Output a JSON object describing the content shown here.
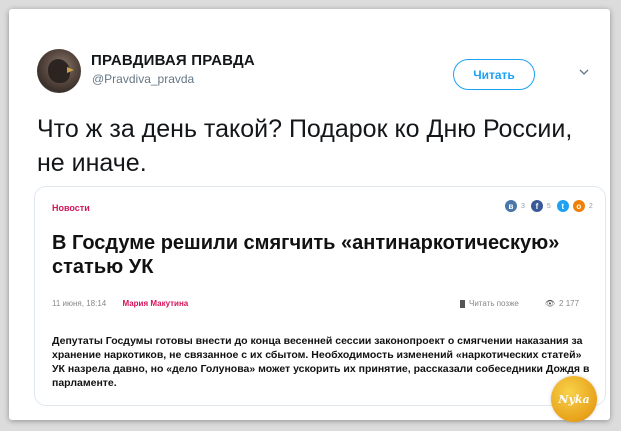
{
  "tweet": {
    "display_name": "ПРАВДИВАЯ ПРАВДА",
    "handle": "@Pravdiva_pravda",
    "follow_label": "Читать",
    "text": "Что ж за день такой? Подарок ко Дню России, не иначе."
  },
  "embed": {
    "section": "Новости",
    "share": {
      "vk_count": "3",
      "fb_count": "5",
      "ok_count": "2"
    },
    "headline": "В Госдуме решили смягчить «антинаркотическую» статью УК",
    "date": "11 июня, 18:14",
    "author": "Мария Макутина",
    "read_later": "Читать позже",
    "views": "2 177",
    "body": "Депутаты Госдумы готовы внести до конца весенней сессии законопроект о смягчении наказания за хранение наркотиков, не связанное с их сбытом. Необходимость изменений «наркотических статей» УК назрела давно, но «дело Голунова» может ускорить их принятие, рассказали собеседники Дождя в парламенте."
  },
  "watermark": "Nyka",
  "colors": {
    "accent": "#1da1f2",
    "section": "#d4145a"
  }
}
